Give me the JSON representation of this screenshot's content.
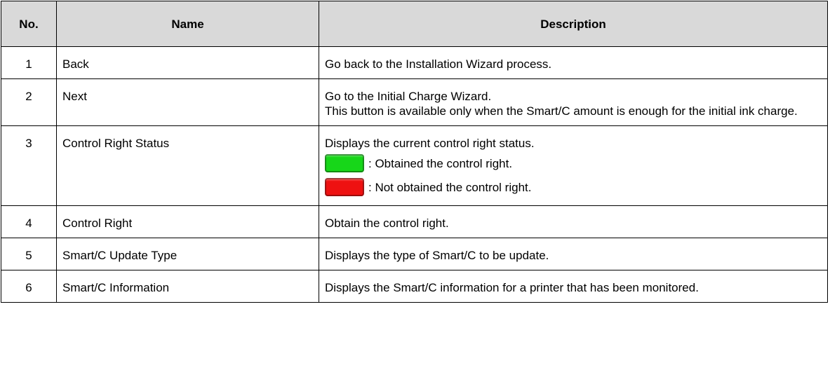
{
  "table": {
    "headers": {
      "no": "No.",
      "name": "Name",
      "description": "Description"
    },
    "rows": [
      {
        "no": "1",
        "name": "Back",
        "desc": [
          "Go back to the Installation Wizard process."
        ]
      },
      {
        "no": "2",
        "name": "Next",
        "desc": [
          "Go to the Initial Charge Wizard.",
          "This button is available only when the Smart/C amount is enough for the initial ink charge."
        ]
      },
      {
        "no": "3",
        "name": "Control Right Status",
        "desc": [
          "Displays the current control right status."
        ],
        "status_items": [
          {
            "color": "#17d619",
            "icon": "green-status-indicator",
            "text": ": Obtained the control right."
          },
          {
            "color": "#ee1111",
            "icon": "red-status-indicator",
            "text": ": Not obtained the control right."
          }
        ]
      },
      {
        "no": "4",
        "name": "Control Right",
        "desc": [
          "Obtain the control right."
        ]
      },
      {
        "no": "5",
        "name": "Smart/C Update Type",
        "desc": [
          "Displays the type of Smart/C to be update."
        ]
      },
      {
        "no": "6",
        "name": "Smart/C Information",
        "desc": [
          "Displays the Smart/C information for a printer that has been monitored."
        ]
      }
    ]
  }
}
